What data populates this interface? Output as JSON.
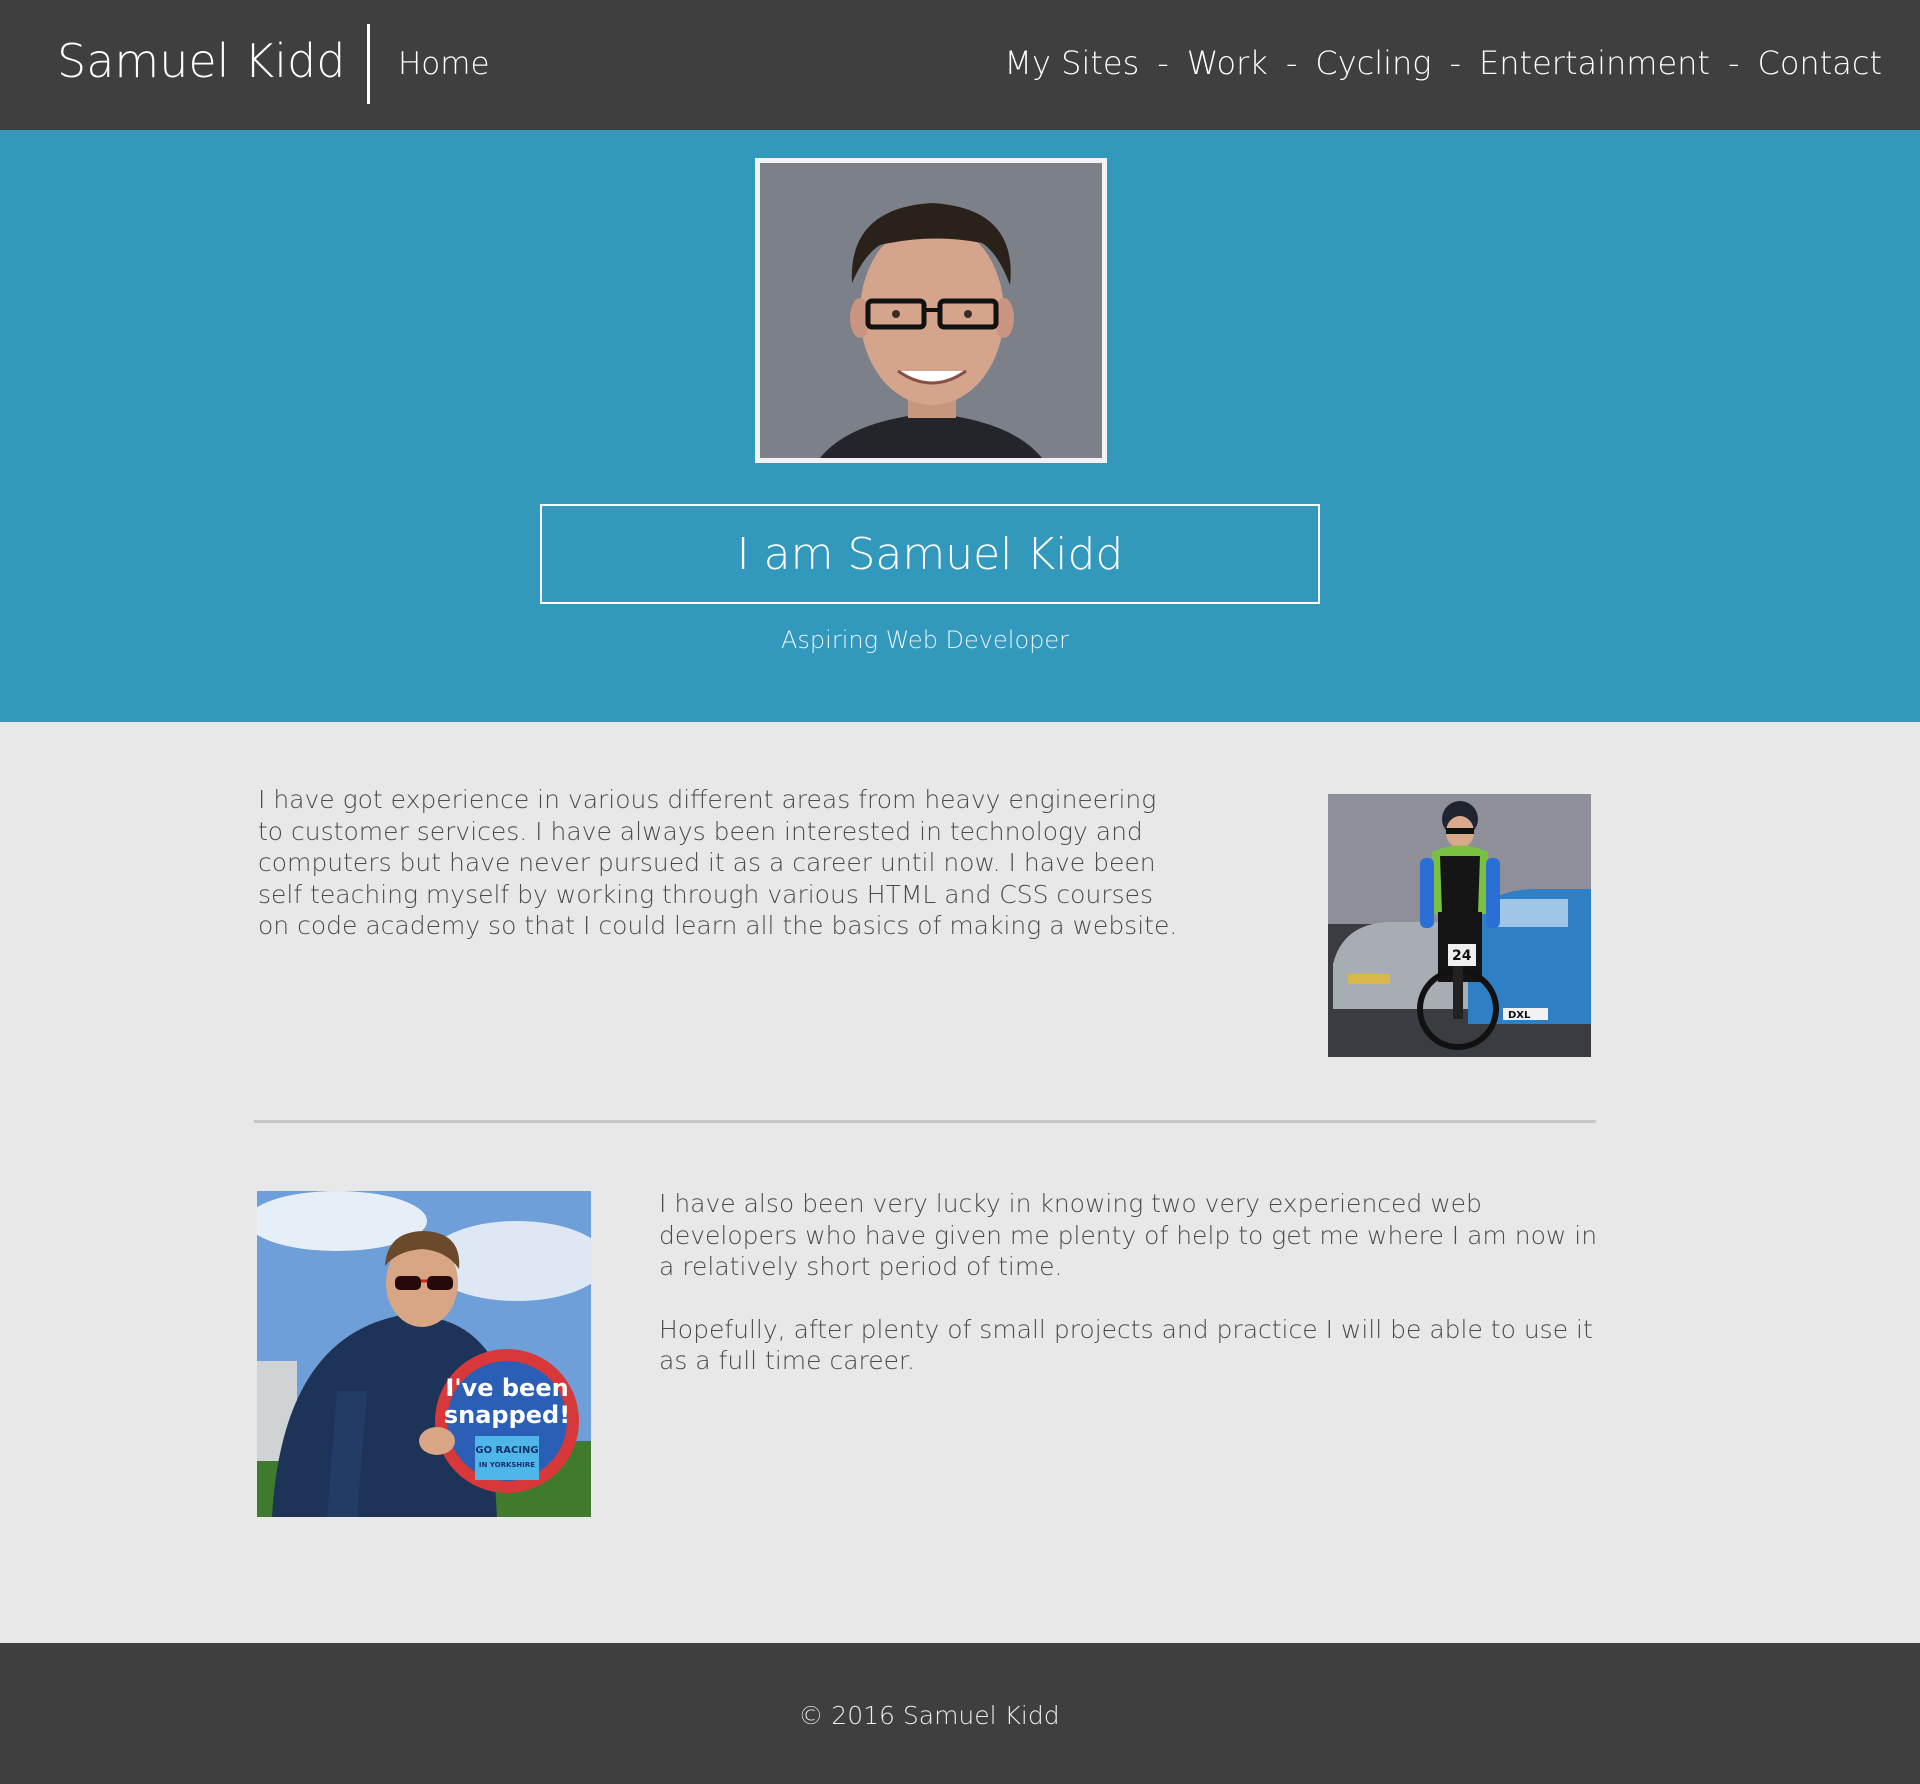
{
  "header": {
    "brand": "Samuel Kidd",
    "home": "Home",
    "nav": [
      {
        "label": "My Sites"
      },
      {
        "label": "Work"
      },
      {
        "label": "Cycling"
      },
      {
        "label": "Entertainment"
      },
      {
        "label": "Contact"
      }
    ],
    "separator": "-"
  },
  "hero": {
    "title": "I am Samuel Kidd",
    "subtitle": "Aspiring Web Developer",
    "portrait_icon": "portrait-photo"
  },
  "content": {
    "intro": "I have got experience in various different areas from heavy engineering to customer services. I have always been interested in technology and computers but have never pursued it as a career until now. I have been self teaching myself by working through various HTML and CSS courses on code academy so that I could learn all the basics of making a website.",
    "paragraph_two": "I have also been very lucky in knowing two very experienced web developers who have given me plenty of help to get me where I am now in a relatively short period of time.",
    "paragraph_three": "Hopefully, after plenty of small projects and practice I will be able to use it as a full time career.",
    "cycling_photo_icon": "cyclist-photo",
    "snapped_photo_icon": "snapped-photo",
    "sign_line_1": "I've been",
    "sign_line_2": "snapped!",
    "sign_card": "GO RACING",
    "sign_card_sub": "IN YORKSHIRE",
    "plate": "DXL",
    "race_number": "24"
  },
  "footer": {
    "copyright": "© 2016 Samuel Kidd"
  },
  "colors": {
    "header_bg": "#3f3f3f",
    "hero_bg": "#3399bc",
    "page_bg": "#e8e8e8",
    "text": "#4a4a4a"
  }
}
